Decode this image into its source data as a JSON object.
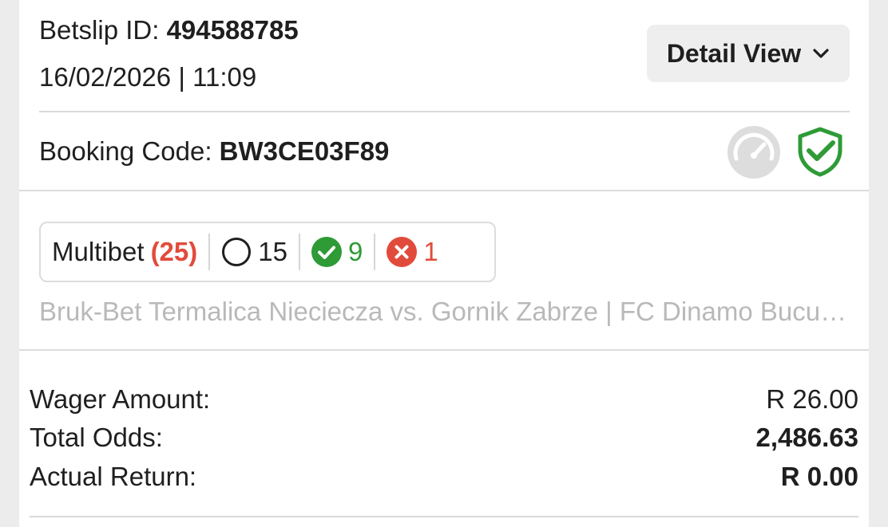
{
  "header": {
    "betslip_label": "Betslip ID:",
    "betslip_id": "494588785",
    "datetime": "16/02/2026 | 11:09",
    "detail_view_label": "Detail View"
  },
  "booking": {
    "label": "Booking Code:",
    "code": "BW3CE03F89"
  },
  "multibet": {
    "label": "Multibet",
    "total": "(25)",
    "open_count": "15",
    "won_count": "9",
    "lost_count": "1",
    "events": "Bruk-Bet Termalica Nieciecza vs. Gornik Zabrze | FC Dinamo Bucuresti vs. ..."
  },
  "summary": {
    "wager_label": "Wager Amount:",
    "wager_value": "R 26.00",
    "odds_label": "Total Odds:",
    "odds_value": "2,486.63",
    "return_label": "Actual Return:",
    "return_value": "R 0.00"
  },
  "colors": {
    "won_green": "#2e9b36",
    "lost_red": "#e14b3b",
    "muted_gray": "#b9b9b9"
  },
  "icons": [
    "chevron-down-icon",
    "speedometer-icon",
    "shield-check-icon",
    "open-circle-icon",
    "check-circle-icon",
    "x-circle-icon"
  ]
}
